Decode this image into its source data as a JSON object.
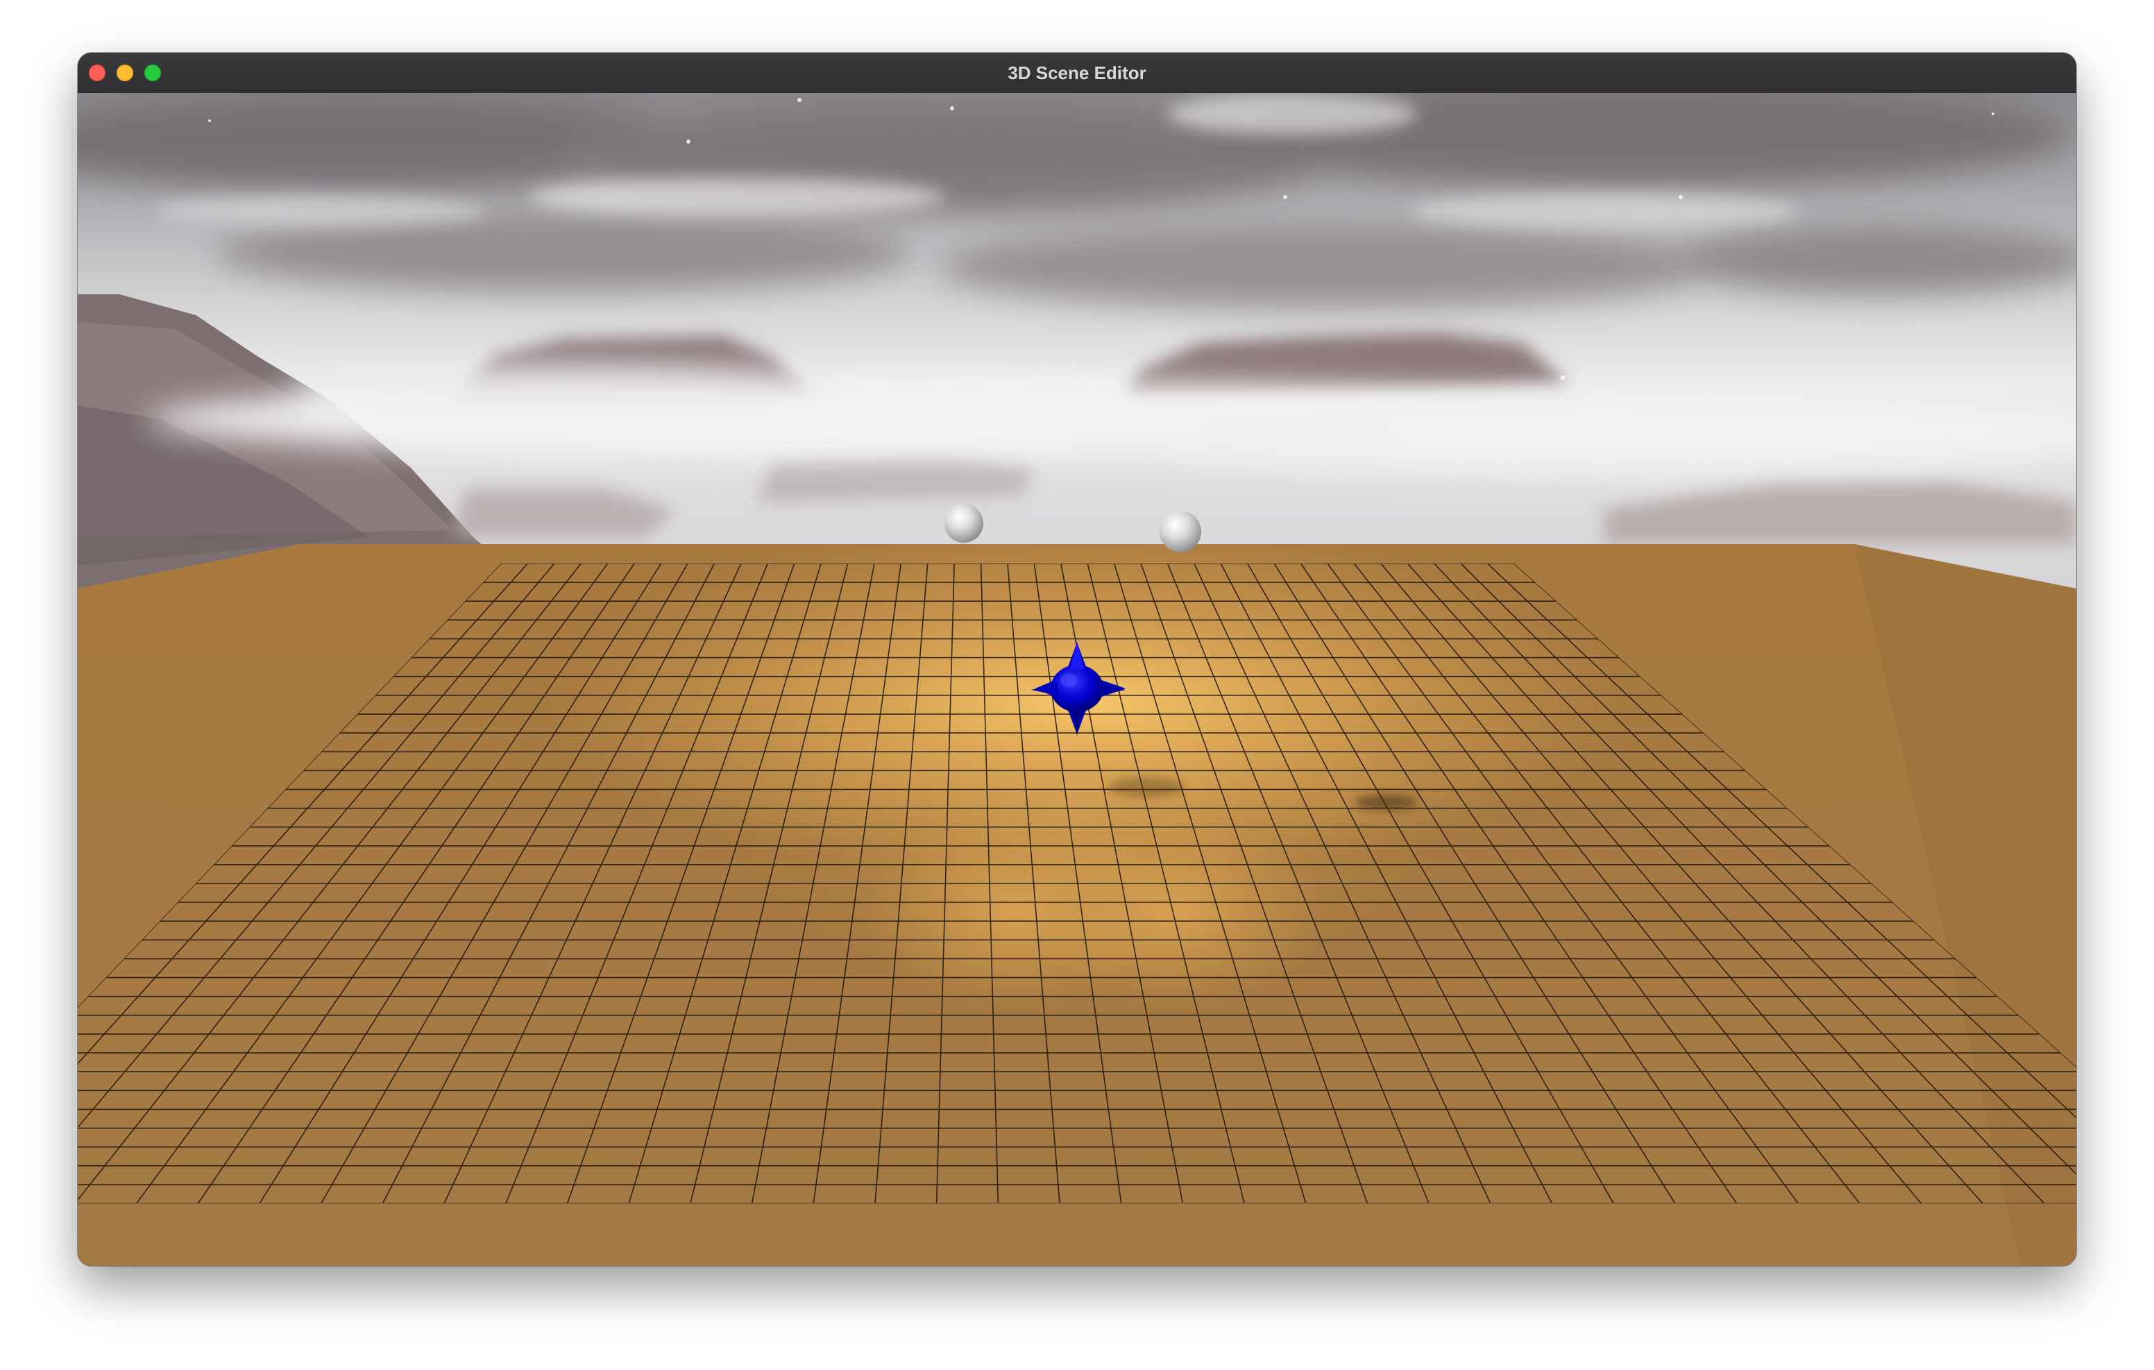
{
  "window": {
    "title": "3D Scene Editor"
  },
  "scene": {
    "skybox": "cloudy-mountain-skybox",
    "ground": "grid-ground-plane",
    "objects": [
      "sphere",
      "sphere",
      "spiked-blue-mesh"
    ],
    "colors": {
      "ground": "#a97d44",
      "ground_highlight": "#f2bc65",
      "grid_line": "#1a1208",
      "selected_object": "#0000cc",
      "sphere": "#e6e6e6",
      "sky": "#d9d9db"
    }
  }
}
